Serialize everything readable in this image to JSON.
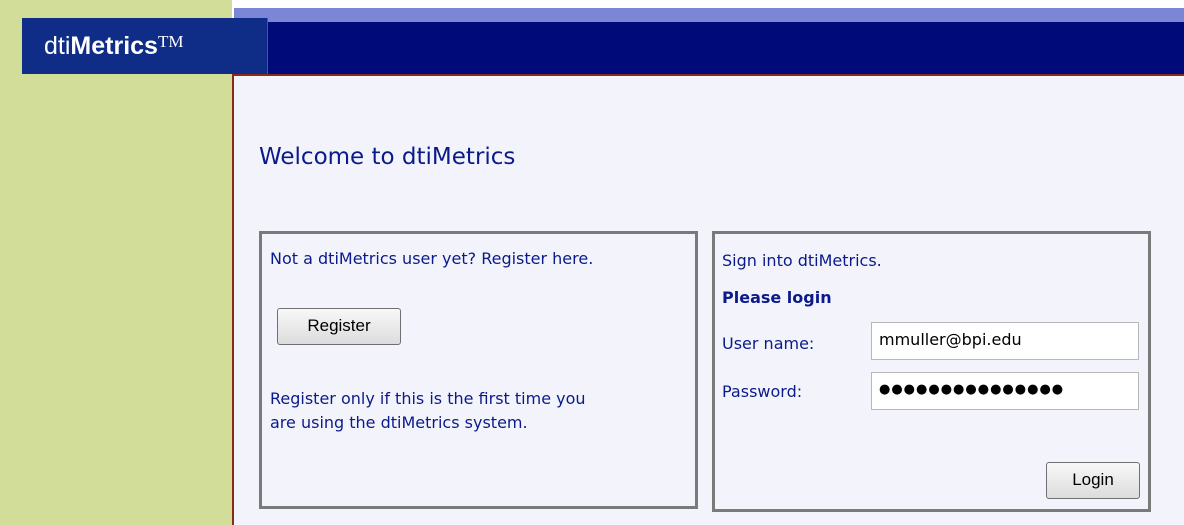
{
  "brand": {
    "logo_light": "dti",
    "logo_bold": "Metrics",
    "logo_tm": "TM"
  },
  "page": {
    "welcome_title": "Welcome to dtiMetrics"
  },
  "register_panel": {
    "intro": "Not a dtiMetrics user yet? Register here.",
    "button_label": "Register",
    "note_line1": "Register only if this is the first time you",
    "note_line2": "are using the dtiMetrics system."
  },
  "login_panel": {
    "intro": "Sign into dtiMetrics.",
    "heading": "Please login",
    "username_label": "User name:",
    "username_value": "mmuller@bpi.edu",
    "password_label": "Password:",
    "password_mask": "●●●●●●●●●●●●●●●",
    "button_label": "Login"
  },
  "colors": {
    "sidebar": "#d3dd9a",
    "header": "#000a78",
    "accent_strip": "#7b86d6",
    "text": "#0b1a8a",
    "panel_border": "#7a7a7a"
  }
}
